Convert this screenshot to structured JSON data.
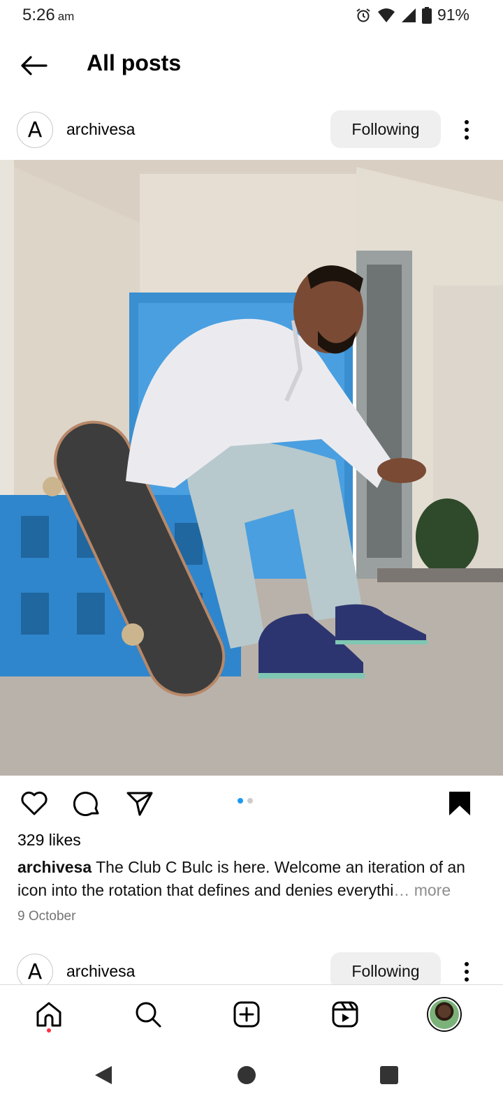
{
  "status_bar": {
    "time": "5:26",
    "ampm": "am",
    "battery": "91%"
  },
  "header": {
    "title": "All posts",
    "back_icon": "arrow-left-icon"
  },
  "posts": [
    {
      "avatar_letter": "A",
      "username": "archivesa",
      "follow_label": "Following",
      "likes": "329 likes",
      "caption_user": "archivesa",
      "caption_text": "The Club C Bulc is here.  Welcome an iteration of an icon into the rotation that defines and denies everythi",
      "caption_more": "… more",
      "date": "9 October",
      "carousel_pages": 2,
      "carousel_active": 1
    },
    {
      "avatar_letter": "A",
      "username": "archivesa",
      "follow_label": "Following"
    }
  ],
  "colors": {
    "accent_blue": "#1d9bf0",
    "notification_red": "#ff3040",
    "button_bg": "#efefef"
  },
  "bottom_nav": [
    "home-icon",
    "search-icon",
    "create-icon",
    "reels-icon",
    "profile-avatar"
  ],
  "system_nav": [
    "back-icon",
    "home-circle-icon",
    "recents-icon"
  ]
}
